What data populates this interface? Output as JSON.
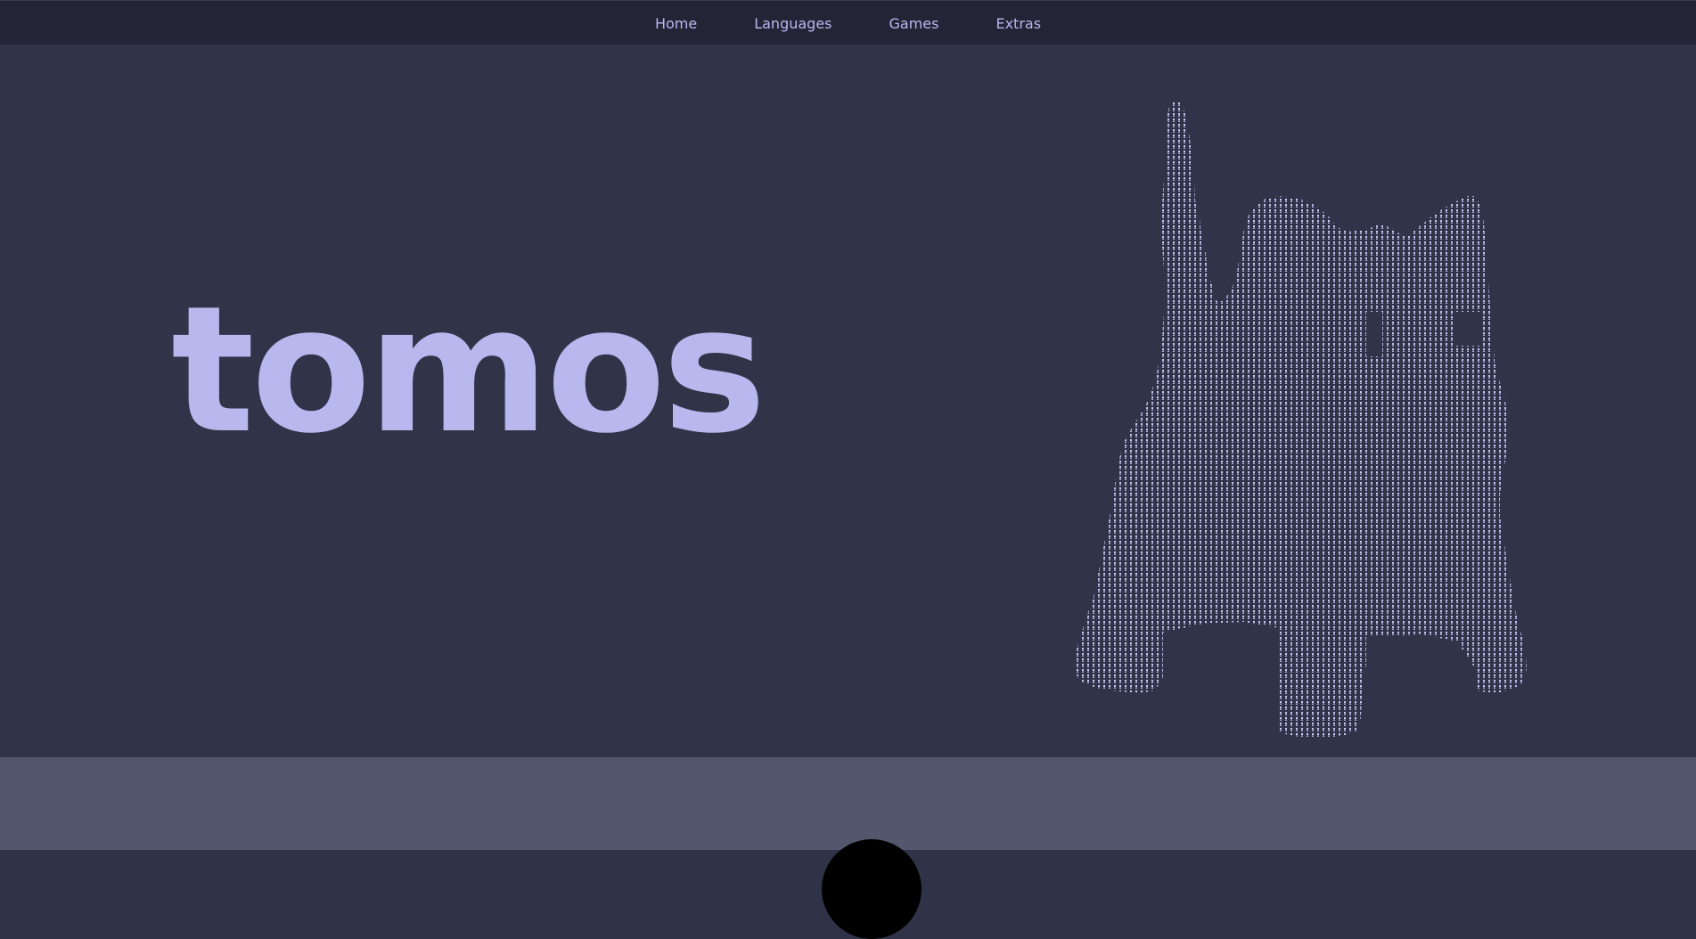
{
  "nav": {
    "items": [
      {
        "label": "Home"
      },
      {
        "label": "Languages"
      },
      {
        "label": "Games"
      },
      {
        "label": "Extras"
      }
    ]
  },
  "hero": {
    "title": "tomos",
    "art_description_icon": "ascii-cat-art-icon"
  },
  "colors": {
    "topbar": "#232536",
    "hero_bg": "#313448",
    "accent": "#b8b7ee",
    "lower_bg": "#52576e"
  }
}
